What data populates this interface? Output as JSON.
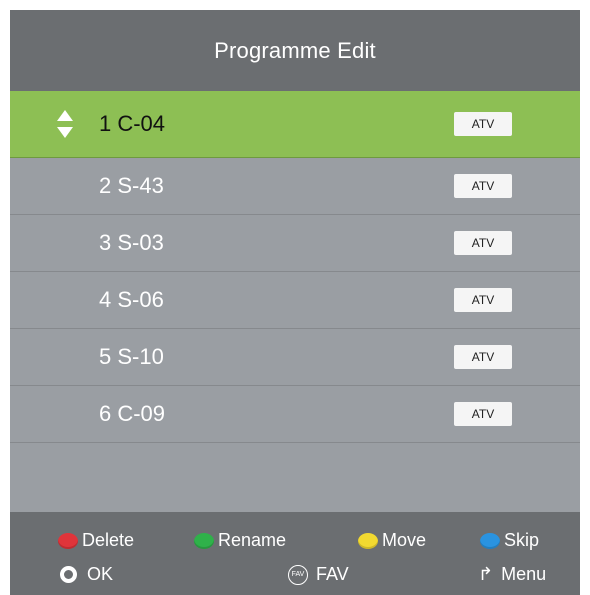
{
  "header": {
    "title": "Programme Edit"
  },
  "programmes": [
    {
      "label": "1 C-04",
      "type": "ATV",
      "selected": true
    },
    {
      "label": "2 S-43",
      "type": "ATV",
      "selected": false
    },
    {
      "label": "3 S-03",
      "type": "ATV",
      "selected": false
    },
    {
      "label": "4 S-06",
      "type": "ATV",
      "selected": false
    },
    {
      "label": "5 S-10",
      "type": "ATV",
      "selected": false
    },
    {
      "label": "6 C-09",
      "type": "ATV",
      "selected": false
    }
  ],
  "footer": {
    "delete_label": "Delete",
    "rename_label": "Rename",
    "move_label": "Move",
    "skip_label": "Skip",
    "ok_label": "OK",
    "fav_label": "FAV",
    "fav_icon_text": "FAV",
    "menu_label": "Menu"
  },
  "colors": {
    "header": "#6b6e71",
    "list_bg": "#9a9ea3",
    "selected_row": "#8dbf54",
    "red_key": "#e0343a",
    "green_key": "#2fb24a",
    "yellow_key": "#f2d930",
    "blue_key": "#2a93e0"
  },
  "icons": {
    "selection": "up-down-arrows-icon",
    "ok": "ok-button-icon",
    "fav": "fav-button-icon",
    "menu": "menu-return-icon"
  }
}
